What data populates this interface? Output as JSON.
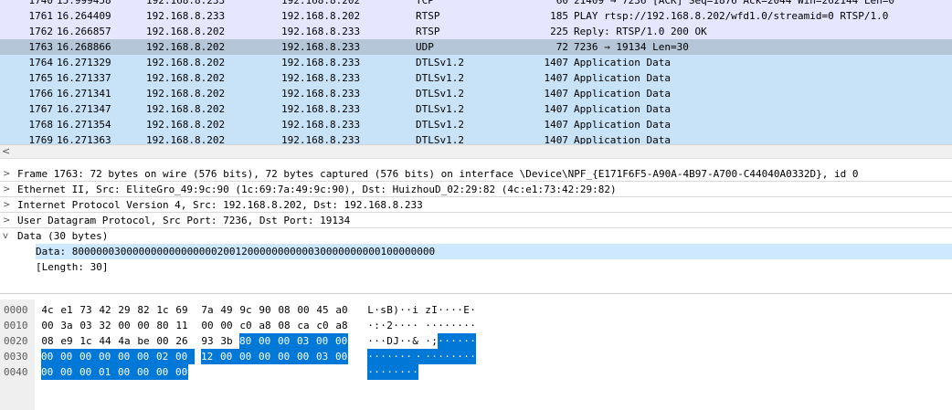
{
  "colors": {
    "selected_row": "#b4c6d8",
    "selected_detail": "#cde8ff",
    "byte_highlight": "#0078d7"
  },
  "packets": [
    {
      "no": "1740",
      "time": "15.999458",
      "src": "192.168.8.233",
      "dst": "192.168.8.202",
      "proto": "TCP",
      "len": "60",
      "info": "21409 → 7236 [ACK] Seq=1876 Ack=2044 Win=262144 Len=0",
      "bg": "#e7e6ff",
      "selected": false
    },
    {
      "no": "1761",
      "time": "16.264409",
      "src": "192.168.8.233",
      "dst": "192.168.8.202",
      "proto": "RTSP",
      "len": "185",
      "info": "PLAY rtsp://192.168.8.202/wfd1.0/streamid=0 RTSP/1.0",
      "bg": "#e7e6ff",
      "selected": false
    },
    {
      "no": "1762",
      "time": "16.266857",
      "src": "192.168.8.202",
      "dst": "192.168.8.233",
      "proto": "RTSP",
      "len": "225",
      "info": "Reply: RTSP/1.0 200 OK",
      "bg": "#e7e6ff",
      "selected": false
    },
    {
      "no": "1763",
      "time": "16.268866",
      "src": "192.168.8.202",
      "dst": "192.168.8.233",
      "proto": "UDP",
      "len": "72",
      "info": "7236 → 19134 Len=30",
      "bg": "#b4c6d8",
      "selected": true
    },
    {
      "no": "1764",
      "time": "16.271329",
      "src": "192.168.8.202",
      "dst": "192.168.8.233",
      "proto": "DTLSv1.2",
      "len": "1407",
      "info": "Application Data",
      "bg": "#c8e3f8",
      "selected": false
    },
    {
      "no": "1765",
      "time": "16.271337",
      "src": "192.168.8.202",
      "dst": "192.168.8.233",
      "proto": "DTLSv1.2",
      "len": "1407",
      "info": "Application Data",
      "bg": "#c8e3f8",
      "selected": false
    },
    {
      "no": "1766",
      "time": "16.271341",
      "src": "192.168.8.202",
      "dst": "192.168.8.233",
      "proto": "DTLSv1.2",
      "len": "1407",
      "info": "Application Data",
      "bg": "#c8e3f8",
      "selected": false
    },
    {
      "no": "1767",
      "time": "16.271347",
      "src": "192.168.8.202",
      "dst": "192.168.8.233",
      "proto": "DTLSv1.2",
      "len": "1407",
      "info": "Application Data",
      "bg": "#c8e3f8",
      "selected": false
    },
    {
      "no": "1768",
      "time": "16.271354",
      "src": "192.168.8.202",
      "dst": "192.168.8.233",
      "proto": "DTLSv1.2",
      "len": "1407",
      "info": "Application Data",
      "bg": "#c8e3f8",
      "selected": false
    },
    {
      "no": "1769",
      "time": "16.271363",
      "src": "192.168.8.202",
      "dst": "192.168.8.233",
      "proto": "DTLSv1.2",
      "len": "1407",
      "info": "Application Data",
      "bg": "#c8e3f8",
      "selected": false
    }
  ],
  "scrollbar": {
    "left_arrow": "<"
  },
  "details": [
    {
      "toggle": ">",
      "text": "Frame 1763: 72 bytes on wire (576 bits), 72 bytes captured (576 bits) on interface \\Device\\NPF_{E171F6F5-A90A-4B97-A700-C44040A0332D}, id 0",
      "level": 0,
      "selected": false
    },
    {
      "toggle": ">",
      "text": "Ethernet II, Src: EliteGro_49:9c:90 (1c:69:7a:49:9c:90), Dst: HuizhouD_02:29:82 (4c:e1:73:42:29:82)",
      "level": 0,
      "selected": false
    },
    {
      "toggle": ">",
      "text": "Internet Protocol Version 4, Src: 192.168.8.202, Dst: 192.168.8.233",
      "level": 0,
      "selected": false
    },
    {
      "toggle": ">",
      "text": "User Datagram Protocol, Src Port: 7236, Dst Port: 19134",
      "level": 0,
      "selected": false
    },
    {
      "toggle": "v",
      "text": "Data (30 bytes)",
      "level": 0,
      "selected": false
    },
    {
      "toggle": "",
      "text": "Data: 800000030000000000000000200120000000000030000000000100000000",
      "level": 1,
      "selected": true
    },
    {
      "toggle": "",
      "text": "[Length: 30]",
      "level": 1,
      "selected": false
    }
  ],
  "bytes": [
    {
      "offset": "0000",
      "hex": [
        "4c",
        "e1",
        "73",
        "42",
        "29",
        "82",
        "1c",
        "69",
        "7a",
        "49",
        "9c",
        "90",
        "08",
        "00",
        "45",
        "a0"
      ],
      "ascii": [
        "L",
        "·",
        "s",
        "B",
        ")",
        "·",
        "·",
        "i",
        "z",
        "I",
        "·",
        "·",
        "·",
        "·",
        "E",
        "·"
      ]
    },
    {
      "offset": "0010",
      "hex": [
        "00",
        "3a",
        "03",
        "32",
        "00",
        "00",
        "80",
        "11",
        "00",
        "00",
        "c0",
        "a8",
        "08",
        "ca",
        "c0",
        "a8"
      ],
      "ascii": [
        "·",
        ":",
        "·",
        "2",
        "·",
        "·",
        "·",
        "·",
        "·",
        "·",
        "·",
        "·",
        "·",
        "·",
        "·",
        "·"
      ]
    },
    {
      "offset": "0020",
      "hex": [
        "08",
        "e9",
        "1c",
        "44",
        "4a",
        "be",
        "00",
        "26",
        "93",
        "3b",
        "80",
        "00",
        "00",
        "03",
        "00",
        "00"
      ],
      "ascii": [
        "·",
        "·",
        "·",
        "D",
        "J",
        "·",
        "·",
        "&",
        "·",
        ";",
        "·",
        "·",
        "·",
        "·",
        "·",
        "·"
      ]
    },
    {
      "offset": "0030",
      "hex": [
        "00",
        "00",
        "00",
        "00",
        "00",
        "00",
        "02",
        "00",
        "12",
        "00",
        "00",
        "00",
        "00",
        "00",
        "03",
        "00"
      ],
      "ascii": [
        "·",
        "·",
        "·",
        "·",
        "·",
        "·",
        "·",
        "·",
        "·",
        "·",
        "·",
        "·",
        "·",
        "·",
        "·",
        "·"
      ]
    },
    {
      "offset": "0040",
      "hex": [
        "00",
        "00",
        "00",
        "01",
        "00",
        "00",
        "00",
        "00"
      ],
      "ascii": [
        "·",
        "·",
        "·",
        "·",
        "·",
        "·",
        "·",
        "·"
      ]
    }
  ],
  "highlight": {
    "from_row": 2,
    "from_col": 10,
    "to_row": 4,
    "to_col": 7
  }
}
